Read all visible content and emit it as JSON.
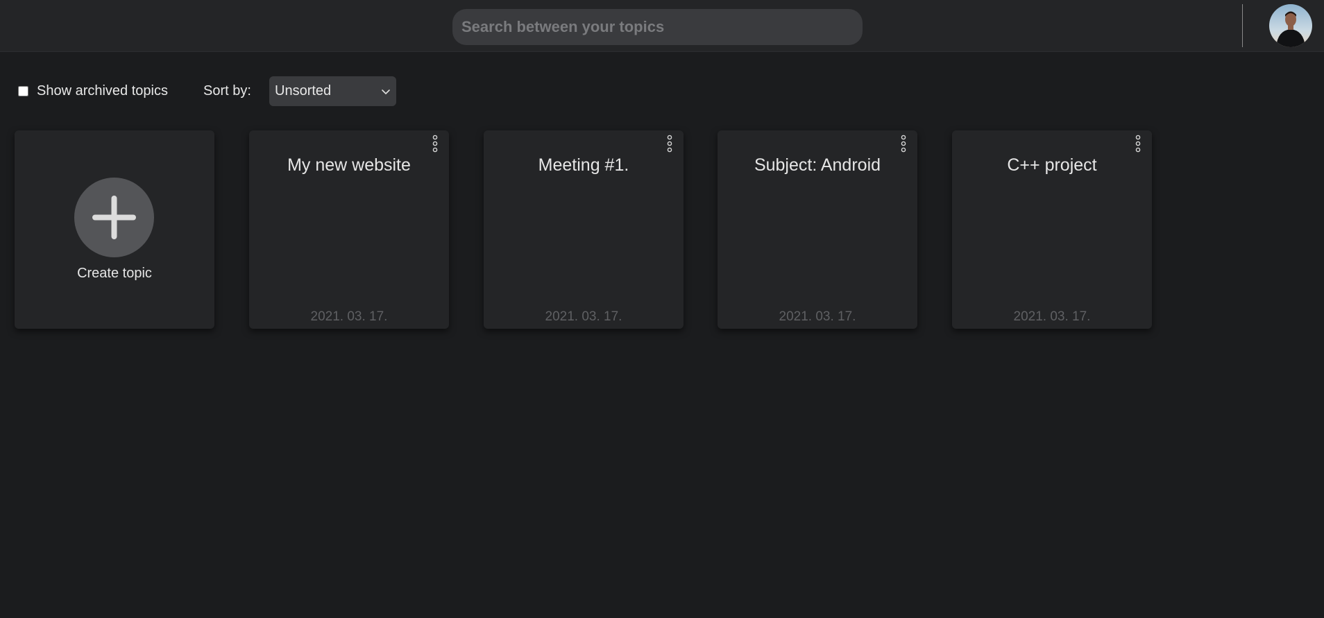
{
  "header": {
    "search_placeholder": "Search between your topics",
    "search_value": "",
    "avatar_icon": "user-avatar"
  },
  "controls": {
    "show_archived_label": "Show archived topics",
    "show_archived_checked": false,
    "sort_label": "Sort by:",
    "sort_value": "Unsorted"
  },
  "create_card": {
    "label": "Create topic",
    "icon": "plus-icon"
  },
  "topics": [
    {
      "title": "My new website",
      "date": "2021. 03. 17."
    },
    {
      "title": "Meeting #1.",
      "date": "2021. 03. 17."
    },
    {
      "title": "Subject: Android",
      "date": "2021. 03. 17."
    },
    {
      "title": "C++ project",
      "date": "2021. 03. 17."
    }
  ],
  "colors": {
    "background": "#1b1c1e",
    "header": "#242527",
    "card": "#242527",
    "input": "#3a3b3e",
    "plus_circle": "#545558",
    "date_text": "#5f6063"
  }
}
